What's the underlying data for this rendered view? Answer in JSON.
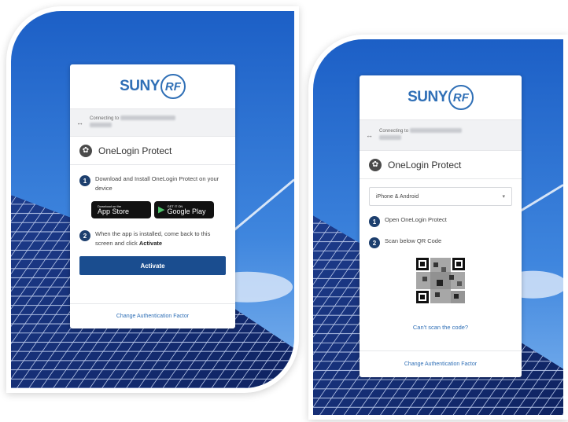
{
  "brand": {
    "logo_text": "SUNY",
    "logo_mark": "RF",
    "accent": "#2f6fb6",
    "button_color": "#1a4d8f",
    "step_badge_color": "#1d3f6e"
  },
  "left_card": {
    "connecting_label": "Connecting to",
    "connecting_icon": "arrows-left-right-icon",
    "app_name": "OneLogin Protect",
    "app_icon": "onelogin-protect-icon",
    "steps": [
      {
        "number": "1",
        "text": "Download and Install OneLogin Protect on your device"
      },
      {
        "number": "2",
        "text_before": "When the app is installed, come back to this screen and click ",
        "text_bold": "Activate"
      }
    ],
    "app_store": {
      "small": "Download on the",
      "big": "App Store",
      "icon": "apple-icon"
    },
    "google_play": {
      "small": "GET IT ON",
      "big": "Google Play",
      "icon": "google-play-icon"
    },
    "activate_label": "Activate",
    "footer_link": "Change Authentication Factor"
  },
  "right_card": {
    "connecting_label": "Connecting to",
    "connecting_icon": "arrows-left-right-icon",
    "app_name": "OneLogin Protect",
    "app_icon": "onelogin-protect-icon",
    "platform_select": "iPhone & Android",
    "steps": [
      {
        "number": "1",
        "text": "Open OneLogin Protect"
      },
      {
        "number": "2",
        "text": "Scan below QR Code"
      }
    ],
    "qr_icon": "qr-code-icon",
    "cant_scan_link": "Can't scan the code?",
    "footer_link": "Change Authentication Factor"
  }
}
